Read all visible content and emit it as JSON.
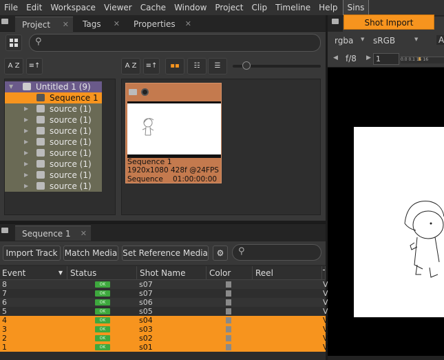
{
  "menubar": {
    "items": [
      "File",
      "Edit",
      "Workspace",
      "Viewer",
      "Cache",
      "Window",
      "Project",
      "Clip",
      "Timeline",
      "Help",
      "Sins"
    ]
  },
  "sins_menu": {
    "item": "Shot Import"
  },
  "project_panel": {
    "tabs": [
      "Project",
      "Tags",
      "Properties"
    ],
    "sort_label": "A Z",
    "tree": {
      "project": "Untitled 1 (9)",
      "sequence": "Sequence 1",
      "sources": [
        "source (1)",
        "source (1)",
        "source (1)",
        "source (1)",
        "source (1)",
        "source (1)",
        "source (1)",
        "source (1)"
      ]
    },
    "bin": {
      "name": "Sequence 1",
      "info": "1920x1080 428f @24FPS",
      "type": "Sequence",
      "timecode": "01:00:00:00"
    }
  },
  "sequence_panel": {
    "tab": "Sequence 1",
    "buttons": {
      "import_track": "Import Track",
      "match_media": "Match Media",
      "set_reference": "Set Reference Media"
    },
    "columns": [
      "Event",
      "Status",
      "Shot Name",
      "Color",
      "Reel",
      "T"
    ],
    "rows": [
      {
        "event": "8",
        "status": "OK",
        "shot": "s07",
        "selected": false,
        "t": "V"
      },
      {
        "event": "7",
        "status": "OK",
        "shot": "s07",
        "selected": false,
        "t": "V"
      },
      {
        "event": "6",
        "status": "OK",
        "shot": "s06",
        "selected": false,
        "t": "V"
      },
      {
        "event": "5",
        "status": "OK",
        "shot": "s05",
        "selected": false,
        "t": "V"
      },
      {
        "event": "4",
        "status": "OK",
        "shot": "s04",
        "selected": true,
        "t": "V"
      },
      {
        "event": "3",
        "status": "OK",
        "shot": "s03",
        "selected": true,
        "t": "V"
      },
      {
        "event": "2",
        "status": "OK",
        "shot": "s02",
        "selected": true,
        "t": "V"
      },
      {
        "event": "1",
        "status": "OK",
        "shot": "s01",
        "selected": true,
        "t": "V"
      }
    ]
  },
  "viewer": {
    "channels": "rgba",
    "colorspace": "sRGB",
    "extra": "A",
    "fstop": "f/8",
    "gain": "1",
    "ruler": "0.0 0.1 15 16"
  },
  "colors": {
    "accent": "#f7941e",
    "ok": "#3ea83e",
    "bin_card": "#c47a4e",
    "project_row": "#6a5a8a",
    "source_row": "#6a6a55"
  }
}
